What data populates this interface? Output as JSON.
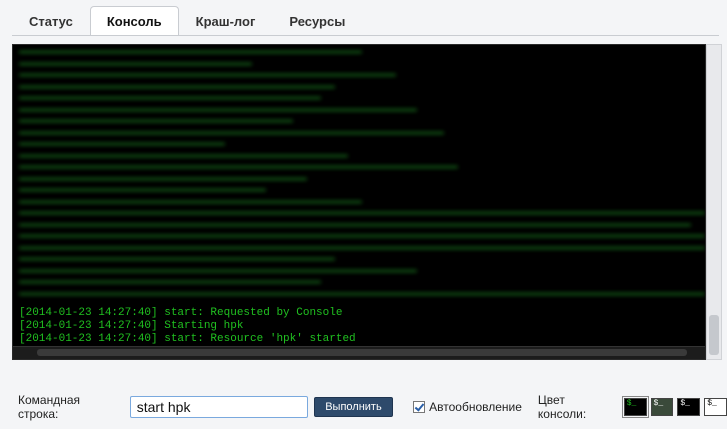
{
  "tabs": [
    {
      "label": "Статус"
    },
    {
      "label": "Консоль",
      "active": true
    },
    {
      "label": "Краш-лог"
    },
    {
      "label": "Ресурсы"
    }
  ],
  "console": {
    "lines": [
      "[2014-01-23 14:27:40] start: Requested by Console",
      "[2014-01-23 14:27:40] Starting hpk",
      "[2014-01-23 14:27:40] start: Resource 'hpk' started"
    ],
    "text_color": "#20c020",
    "background": "#000000"
  },
  "command": {
    "label": "Командная строка:",
    "value": "start hpk",
    "run_label": "Выполнить"
  },
  "autoupdate": {
    "label": "Автообновление",
    "checked": true
  },
  "console_color": {
    "label": "Цвет консоли:",
    "swatch_text": "$_",
    "swatches": [
      {
        "bg": "#000000",
        "fg": "#20c020"
      },
      {
        "bg": "#3a4a3a",
        "fg": "#ffffff"
      },
      {
        "bg": "#000000",
        "fg": "#ffffff"
      },
      {
        "bg": "#ffffff",
        "fg": "#000000"
      }
    ]
  }
}
